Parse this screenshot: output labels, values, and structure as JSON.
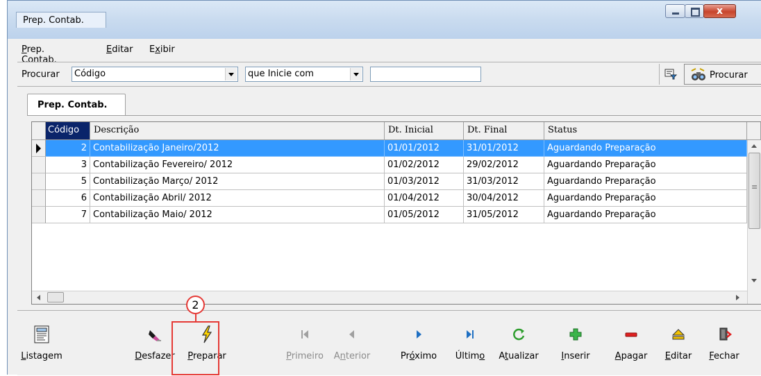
{
  "window": {
    "title": "Prep. Contab."
  },
  "menu": [
    {
      "label": "Prep. Contab.",
      "key": "P"
    },
    {
      "label": "Editar",
      "key": "E"
    },
    {
      "label": "Exibir",
      "key": "x"
    }
  ],
  "search": {
    "label": "Procurar",
    "field_value": "Código",
    "condition_value": "que Inicie com",
    "text_value": "",
    "button_label": "Procurar"
  },
  "tab": {
    "label": "Prep. Contab."
  },
  "grid": {
    "columns": [
      "Código",
      "Descrição",
      "Dt. Inicial",
      "Dt. Final",
      "Status"
    ],
    "rows": [
      {
        "codigo": "2",
        "descricao": "Contabilização Janeiro/2012",
        "inicial": "01/01/2012",
        "final": "31/01/2012",
        "status": "Aguardando Preparação"
      },
      {
        "codigo": "3",
        "descricao": "Contabilização Fevereiro/ 2012",
        "inicial": "01/02/2012",
        "final": "29/02/2012",
        "status": "Aguardando Preparação"
      },
      {
        "codigo": "5",
        "descricao": "Contabilização Março/ 2012",
        "inicial": "01/03/2012",
        "final": "31/03/2012",
        "status": "Aguardando Preparação"
      },
      {
        "codigo": "6",
        "descricao": "Contabilização Abril/ 2012",
        "inicial": "01/04/2012",
        "final": "30/04/2012",
        "status": "Aguardando Preparação"
      },
      {
        "codigo": "7",
        "descricao": "Contabilização Maio/ 2012",
        "inicial": "01/05/2012",
        "final": "31/05/2012",
        "status": "Aguardando Preparação"
      }
    ],
    "selected_row": 0
  },
  "toolbar": {
    "listagem": {
      "label": "Listagem",
      "icon": "report-icon"
    },
    "desfazer": {
      "label": "Desfazer",
      "icon": "eraser-icon"
    },
    "preparar": {
      "label": "Preparar",
      "icon": "lightning-icon"
    },
    "primeiro": {
      "label": "Primeiro",
      "icon": "first-record-icon",
      "enabled": false
    },
    "anterior": {
      "label": "Anterior",
      "icon": "previous-record-icon",
      "enabled": false
    },
    "proximo": {
      "label": "Próximo",
      "icon": "next-record-icon"
    },
    "ultimo": {
      "label": "Último",
      "icon": "last-record-icon"
    },
    "atualizar": {
      "label": "Atualizar",
      "icon": "refresh-icon"
    },
    "inserir": {
      "label": "Inserir",
      "icon": "plus-icon"
    },
    "apagar": {
      "label": "Apagar",
      "icon": "minus-icon"
    },
    "editar": {
      "label": "Editar",
      "icon": "eject-edit-icon"
    },
    "fechar": {
      "label": "Fechar",
      "icon": "exit-door-icon"
    }
  },
  "annotation": {
    "step": "2",
    "color": "#e53935"
  },
  "colors": {
    "selection": "#3399ff",
    "header_selected": "#0a246a"
  }
}
